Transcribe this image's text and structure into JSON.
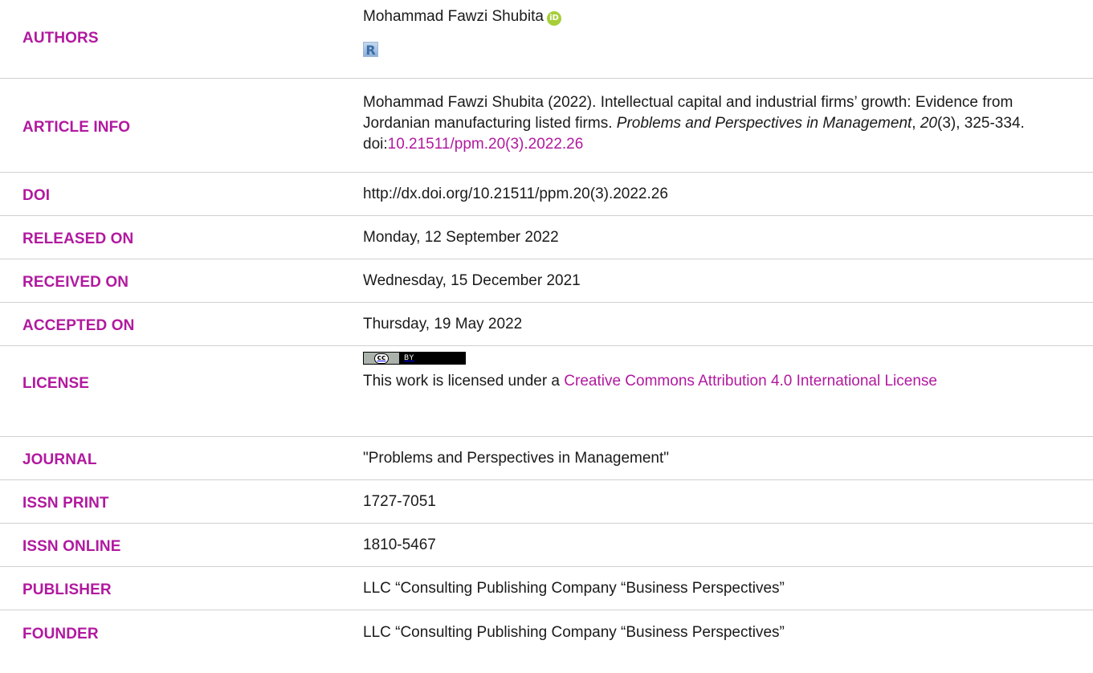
{
  "rows": {
    "authors": {
      "label": "AUTHORS",
      "name": "Mohammad Fawzi Shubita",
      "orcid_icon_text": "iD",
      "researcherid_icon_text": "R"
    },
    "article_info": {
      "label": "ARTICLE INFO",
      "text_main": "Mohammad Fawzi Shubita (2022). Intellectual capital and industrial firms’ growth: Evidence from Jordanian manufacturing listed firms. ",
      "journal_italic": "Problems and Perspectives in Management",
      "comma1": ", ",
      "volume_italic": "20",
      "issue_pages": "(3), 325-334. doi:",
      "doi_link": "10.21511/ppm.20(3).2022.26"
    },
    "doi": {
      "label": "DOI",
      "value": "http://dx.doi.org/10.21511/ppm.20(3).2022.26"
    },
    "released_on": {
      "label": "RELEASED ON",
      "value": "Monday, 12 September 2022"
    },
    "received_on": {
      "label": "RECEIVED ON",
      "value": "Wednesday, 15 December 2021"
    },
    "accepted_on": {
      "label": "ACCEPTED ON",
      "value": "Thursday, 19 May 2022"
    },
    "license": {
      "label": "LICENSE",
      "badge_cc": "cc",
      "badge_by": "BY",
      "text_prefix": "This work is licensed under a ",
      "link_text": "Creative Commons Attribution 4.0 International License"
    },
    "journal": {
      "label": "JOURNAL",
      "value": "\"Problems and Perspectives in Management\""
    },
    "issn_print": {
      "label": "ISSN PRINT",
      "value": "1727-7051"
    },
    "issn_online": {
      "label": "ISSN ONLINE",
      "value": "1810-5467"
    },
    "publisher": {
      "label": "PUBLISHER",
      "value": "LLC “Consulting Publishing Company “Business Perspectives”"
    },
    "founder": {
      "label": "FOUNDER",
      "value": "LLC “Consulting Publishing Company “Business Perspectives”"
    }
  },
  "colors": {
    "label": "#b1199f",
    "link": "#b1199f",
    "text": "#1a1a1a",
    "separator": "#d0d0d0",
    "orcid": "#a6ce39"
  }
}
